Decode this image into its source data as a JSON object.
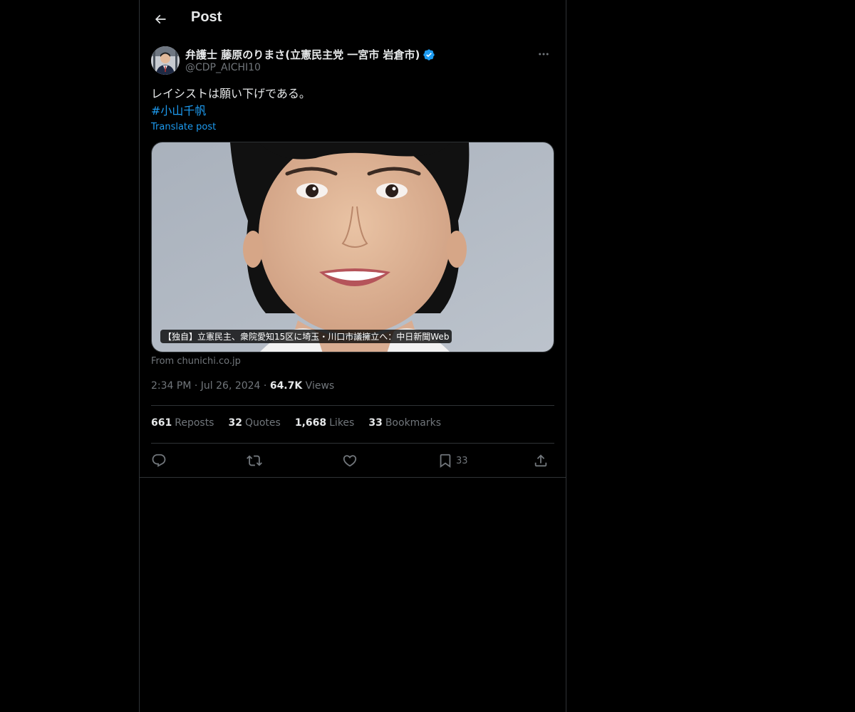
{
  "header": {
    "title": "Post",
    "back_icon": "arrow-left-icon"
  },
  "author": {
    "display_name": "弁護士 藤原のりまさ(立憲民主党 一宮市 岩倉市)",
    "handle": "@CDP_AICHI10",
    "verified": true,
    "badge_color": "#1d9bf0"
  },
  "post": {
    "text": "レイシストは願い下げである。",
    "hashtag": "#小山千帆",
    "translate_label": "Translate post"
  },
  "card": {
    "caption": "【独自】立憲民主、衆院愛知15区に埼玉・川口市議擁立へ：中日新聞Web",
    "source": "From chunichi.co.jp"
  },
  "meta": {
    "time": "2:34 PM",
    "date": "Jul 26, 2024",
    "views_count": "64.7K",
    "views_label": "Views"
  },
  "stats": {
    "reposts_count": "661",
    "reposts_label": "Reposts",
    "quotes_count": "32",
    "quotes_label": "Quotes",
    "likes_count": "1,668",
    "likes_label": "Likes",
    "bookmarks_count": "33",
    "bookmarks_label": "Bookmarks"
  },
  "actions": {
    "reply_icon": "reply-icon",
    "repost_icon": "repost-icon",
    "like_icon": "like-icon",
    "bookmark_icon": "bookmark-icon",
    "bookmark_count": "33",
    "share_icon": "share-icon"
  },
  "colors": {
    "background": "#000000",
    "text_primary": "#e7e9ea",
    "text_secondary": "#71767b",
    "accent": "#1d9bf0",
    "border": "#2f3336"
  }
}
